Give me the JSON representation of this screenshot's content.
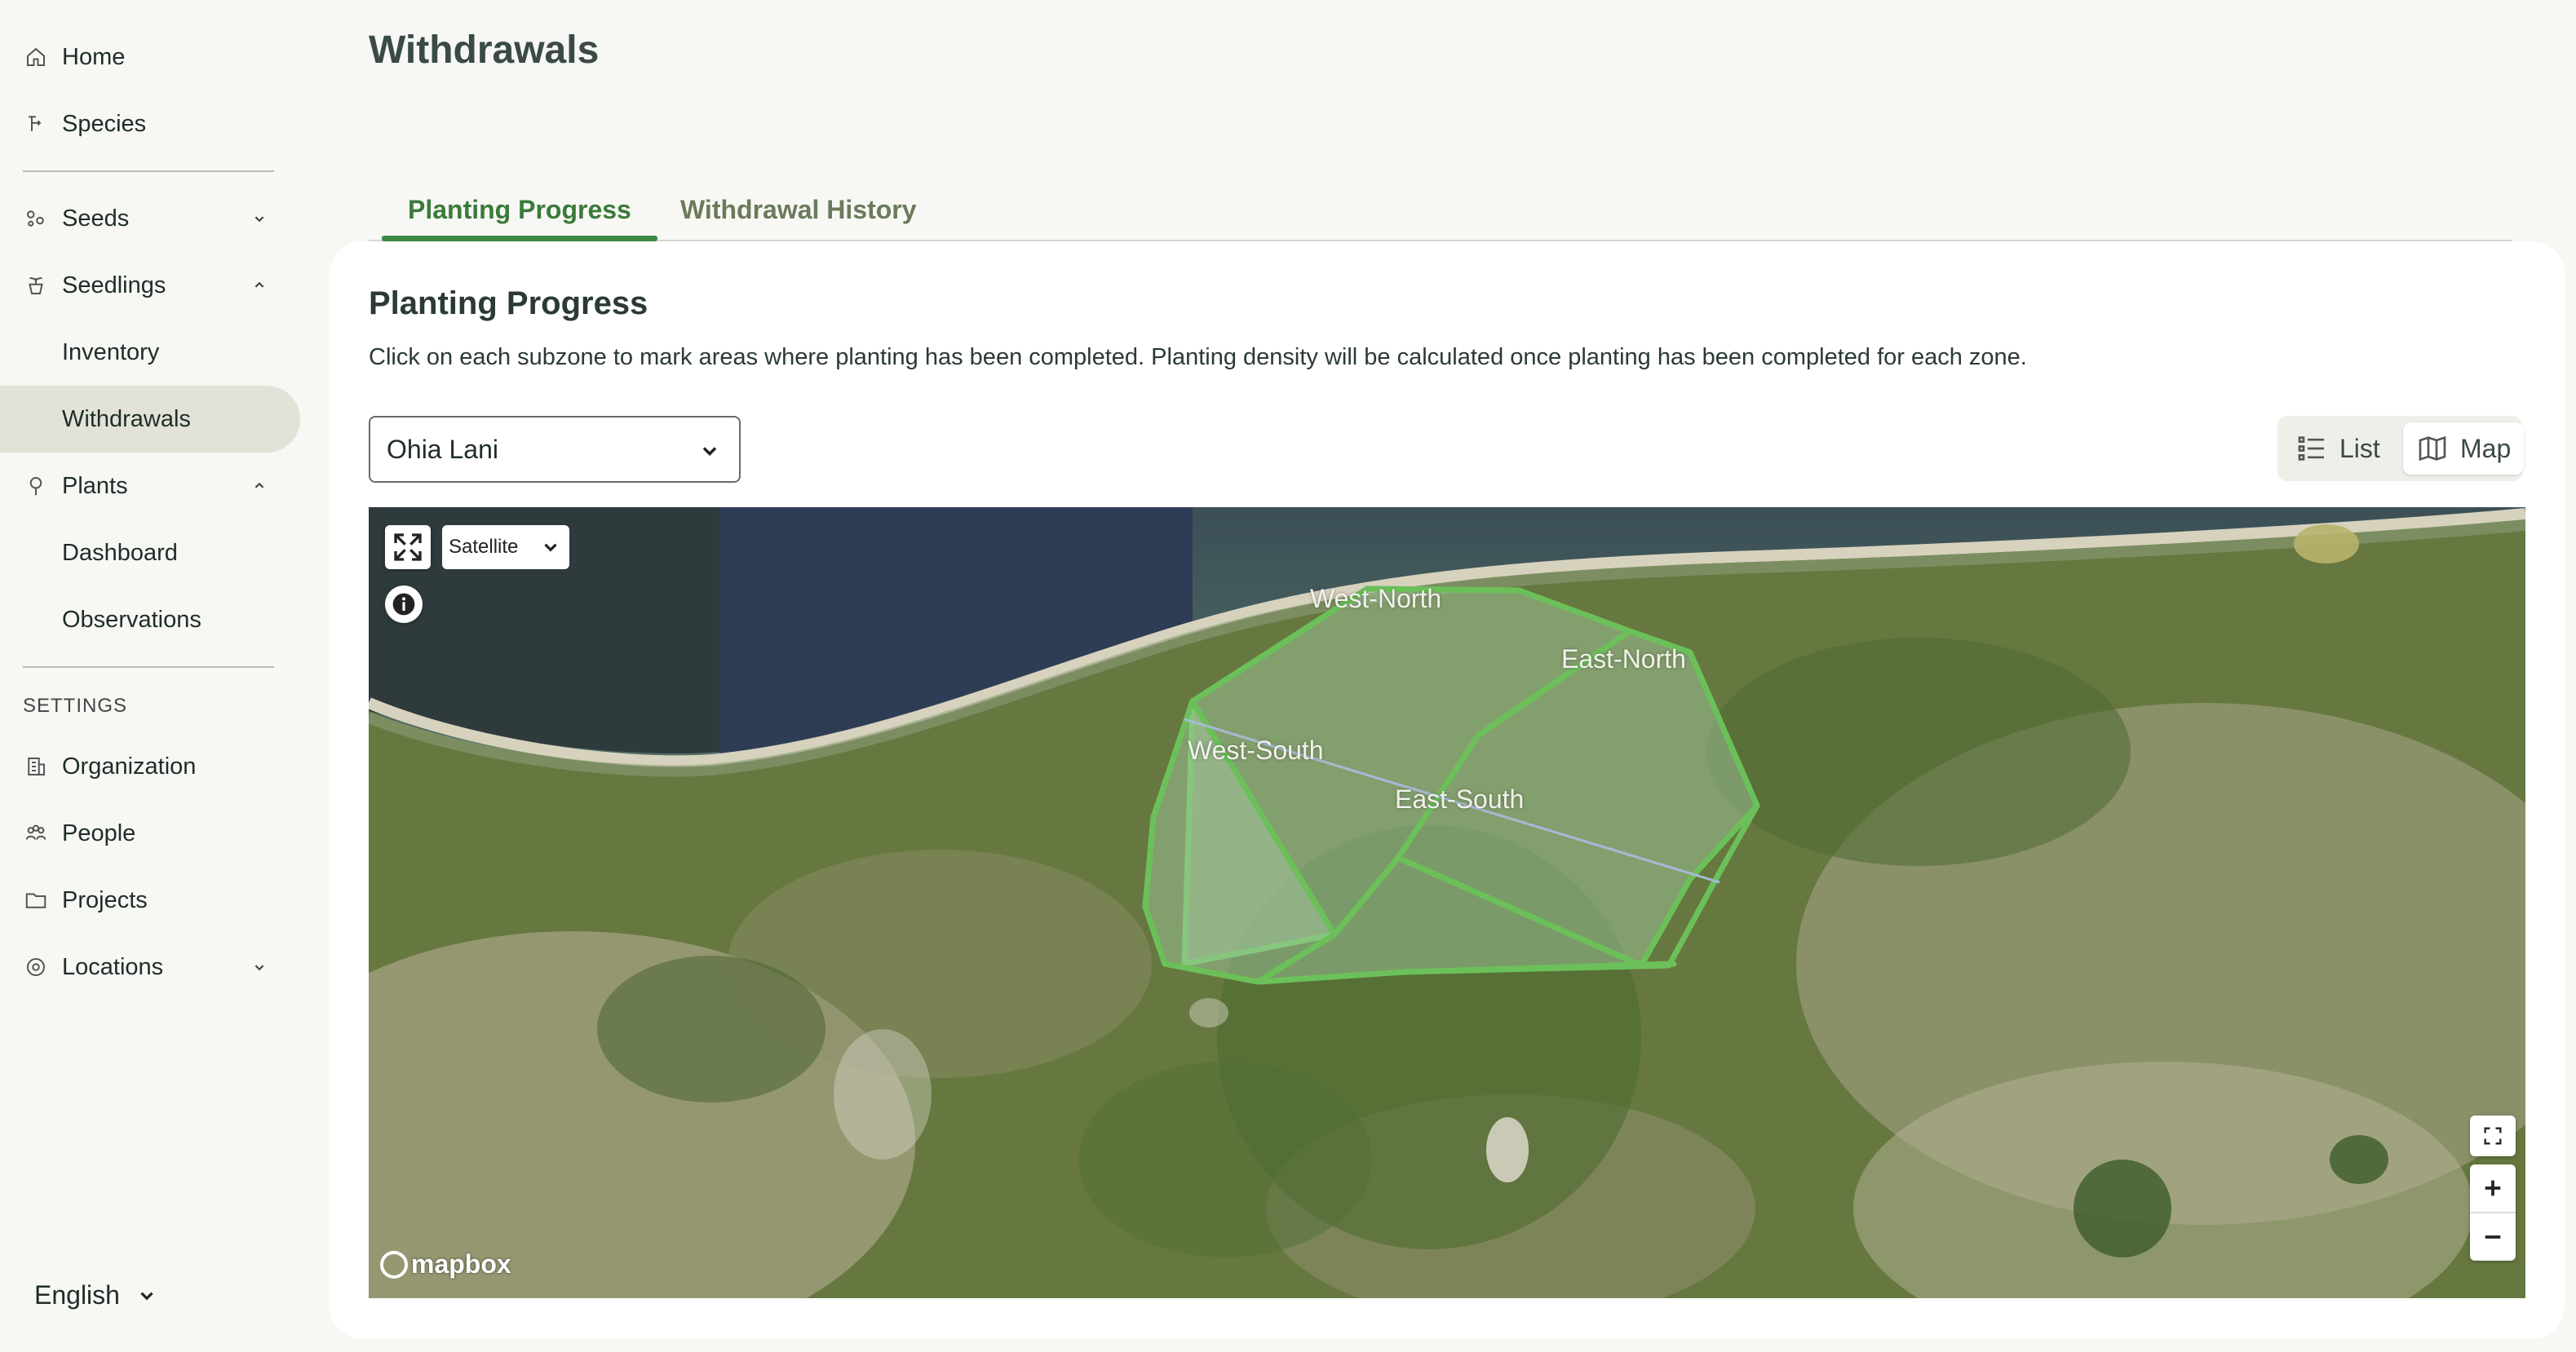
{
  "sidebar": {
    "items": [
      {
        "label": "Home"
      },
      {
        "label": "Species"
      },
      {
        "label": "Seeds"
      },
      {
        "label": "Seedlings"
      },
      {
        "label": "Inventory"
      },
      {
        "label": "Withdrawals"
      },
      {
        "label": "Plants"
      },
      {
        "label": "Dashboard"
      },
      {
        "label": "Observations"
      },
      {
        "label": "Organization"
      },
      {
        "label": "People"
      },
      {
        "label": "Projects"
      },
      {
        "label": "Locations"
      }
    ],
    "settings_label": "SETTINGS",
    "language": "English"
  },
  "page": {
    "title": "Withdrawals"
  },
  "tabs": [
    {
      "label": "Planting Progress"
    },
    {
      "label": "Withdrawal History"
    }
  ],
  "card": {
    "title": "Planting Progress",
    "description": "Click on each subzone to mark areas where planting has been completed. Planting density will be calculated once planting has been completed for each zone."
  },
  "site_select": {
    "value": "Ohia Lani"
  },
  "view_toggle": {
    "list_label": "List",
    "map_label": "Map",
    "selected": "Map"
  },
  "map": {
    "layer": "Satellite",
    "attribution": "mapbox",
    "zones": [
      {
        "label": "West-North"
      },
      {
        "label": "East-North"
      },
      {
        "label": "West-South"
      },
      {
        "label": "East-South"
      }
    ],
    "colors": {
      "zone_stroke": "#6cc05a",
      "zone_fill": "#9fc8a0",
      "accent": "#3e8a44"
    }
  }
}
